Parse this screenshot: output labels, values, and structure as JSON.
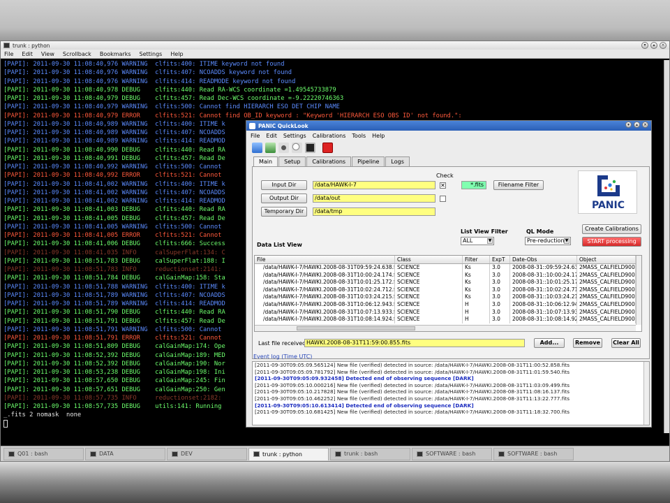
{
  "terminal": {
    "title": "trunk : python",
    "menu": [
      "File",
      "Edit",
      "View",
      "Scrollback",
      "Bookmarks",
      "Settings",
      "Help"
    ],
    "lines": [
      {
        "c": "blue",
        "t": "[PAPI]: 2011-09-30 11:08:40,976 WARNING  clfits:400: ITIME keyword not found"
      },
      {
        "c": "blue",
        "t": "[PAPI]: 2011-09-30 11:08:40,976 WARNING  clfits:407: NCOADDS keyword not found"
      },
      {
        "c": "blue",
        "t": "[PAPI]: 2011-09-30 11:08:40,976 WARNING  clfits:414: READMODE keyword not found"
      },
      {
        "c": "green",
        "t": "[PAPI]: 2011-09-30 11:08:40,978 DEBUG    clfits:440: Read RA-WCS coordinate =1.49545733879"
      },
      {
        "c": "green",
        "t": "[PAPI]: 2011-09-30 11:08:40,979 DEBUG    clfits:457: Read Dec-WCS coordinate =-9.22220746363"
      },
      {
        "c": "blue",
        "t": "[PAPI]: 2011-09-30 11:08:40,979 WARNING  clfits:500: Cannot find HIERARCH ESO DET CHIP NAME"
      },
      {
        "c": "red",
        "t": "[PAPI]: 2011-09-30 11:08:40,979 ERROR    clfits:521: Cannot find OB_ID keyword : \"Keyword 'HIERARCH ESO OBS ID' not found.\":"
      },
      {
        "c": "blue",
        "t": "[PAPI]: 2011-09-30 11:08:40,989 WARNING  clfits:400: ITIME k"
      },
      {
        "c": "blue",
        "t": "[PAPI]: 2011-09-30 11:08:40,989 WARNING  clfits:407: NCOADDS"
      },
      {
        "c": "blue",
        "t": "[PAPI]: 2011-09-30 11:08:40,989 WARNING  clfits:414: READMOD"
      },
      {
        "c": "green",
        "t": "[PAPI]: 2011-09-30 11:08:40,990 DEBUG    clfits:440: Read RA"
      },
      {
        "c": "green",
        "t": "[PAPI]: 2011-09-30 11:08:40,991 DEBUG    clfits:457: Read De"
      },
      {
        "c": "blue",
        "t": "[PAPI]: 2011-09-30 11:08:40,992 WARNING  clfits:500: Cannot"
      },
      {
        "c": "red",
        "t": "[PAPI]: 2011-09-30 11:08:40,992 ERROR    clfits:521: Cannot"
      },
      {
        "c": "blue",
        "t": "[PAPI]: 2011-09-30 11:08:41,002 WARNING  clfits:400: ITIME k"
      },
      {
        "c": "blue",
        "t": "[PAPI]: 2011-09-30 11:08:41,002 WARNING  clfits:407: NCOADDS"
      },
      {
        "c": "blue",
        "t": "[PAPI]: 2011-09-30 11:08:41,002 WARNING  clfits:414: READMOD"
      },
      {
        "c": "green",
        "t": "[PAPI]: 2011-09-30 11:08:41,003 DEBUG    clfits:440: Read RA"
      },
      {
        "c": "green",
        "t": "[PAPI]: 2011-09-30 11:08:41,005 DEBUG    clfits:457: Read De"
      },
      {
        "c": "blue",
        "t": "[PAPI]: 2011-09-30 11:08:41,005 WARNING  clfits:500: Cannot"
      },
      {
        "c": "red",
        "t": "[PAPI]: 2011-09-30 11:08:41,005 ERROR    clfits:521: Cannot"
      },
      {
        "c": "green",
        "t": "[PAPI]: 2011-09-30 11:08:41,006 DEBUG    clfits:666: Success"
      },
      {
        "c": "dred",
        "t": "[PAPI]: 2011-09-30 11:08:41,035 INFO     calSuperFlat:134: C"
      },
      {
        "c": "green",
        "t": "[PAPI]: 2011-09-30 11:08:51,783 DEBUG    calSuperFlat:188: I"
      },
      {
        "c": "dred",
        "t": "[PAPI]: 2011-09-30 11:08:51,783 INFO     reductionset:2141:"
      },
      {
        "c": "green",
        "t": "[PAPI]: 2011-09-30 11:08:51,784 DEBUG    calGainMap:158: Sta"
      },
      {
        "c": "blue",
        "t": "[PAPI]: 2011-09-30 11:08:51,788 WARNING  clfits:400: ITIME k"
      },
      {
        "c": "blue",
        "t": "[PAPI]: 2011-09-30 11:08:51,789 WARNING  clfits:407: NCOADDS"
      },
      {
        "c": "blue",
        "t": "[PAPI]: 2011-09-30 11:08:51,789 WARNING  clfits:414: READMOD"
      },
      {
        "c": "green",
        "t": "[PAPI]: 2011-09-30 11:08:51,790 DEBUG    clfits:440: Read RA"
      },
      {
        "c": "green",
        "t": "[PAPI]: 2011-09-30 11:08:51,791 DEBUG    clfits:457: Read De"
      },
      {
        "c": "blue",
        "t": "[PAPI]: 2011-09-30 11:08:51,791 WARNING  clfits:500: Cannot"
      },
      {
        "c": "red",
        "t": "[PAPI]: 2011-09-30 11:08:51,791 ERROR    clfits:521: Cannot"
      },
      {
        "c": "green",
        "t": "[PAPI]: 2011-09-30 11:08:51,809 DEBUG    calGainMap:174: Ope"
      },
      {
        "c": "green",
        "t": "[PAPI]: 2011-09-30 11:08:52,392 DEBUG    calGainMap:189: MED"
      },
      {
        "c": "green",
        "t": "[PAPI]: 2011-09-30 11:08:52,392 DEBUG    calGainMap:190: Nor"
      },
      {
        "c": "green",
        "t": "[PAPI]: 2011-09-30 11:08:53,238 DEBUG    calGainMap:198: Ini"
      },
      {
        "c": "green",
        "t": "[PAPI]: 2011-09-30 11:08:57,650 DEBUG    calGainMap:245: Fin"
      },
      {
        "c": "green",
        "t": "[PAPI]: 2011-09-30 11:08:57,651 DEBUG    calGainMap:250: Gen"
      },
      {
        "c": "dred",
        "t": "[PAPI]: 2011-09-30 11:08:57,735 INFO     reductionset:2182:"
      },
      {
        "c": "green",
        "t": "[PAPI]: 2011-09-30 11:08:57,735 DEBUG    utils:141: Running"
      },
      {
        "c": "white",
        "t": "_.fits 2 nomask  none"
      }
    ],
    "tabs": [
      {
        "label": "Q01 : bash",
        "active": false
      },
      {
        "label": "DATA",
        "active": false
      },
      {
        "label": "DEV",
        "active": false
      },
      {
        "label": "trunk : python",
        "active": true
      },
      {
        "label": "trunk : bash",
        "active": false
      },
      {
        "label": "SOFTWARE : bash",
        "active": false
      },
      {
        "label": "SOFTWARE : bash",
        "active": false
      }
    ]
  },
  "quicklook": {
    "title": "PANIC QuickLook",
    "menu": [
      "File",
      "Edit",
      "Settings",
      "Calibrations",
      "Tools",
      "Help"
    ],
    "tabs": [
      "Main",
      "Setup",
      "Calibrations",
      "Pipeline",
      "Logs"
    ],
    "main": {
      "check_label": "Check",
      "input_dir_button": "Input Dir",
      "input_dir_value": "/data/HAWK-I-7",
      "output_dir_button": "Output Dir",
      "output_dir_value": "/data/out",
      "temp_dir_button": "Temporary Dir",
      "temp_dir_value": "/data/tmp",
      "filter_pattern": "*.fits",
      "filename_filter_button": "Filename Filter",
      "logo_text": "PANIC",
      "list_view_filter_label": "List View Filter",
      "list_view_filter_value": "ALL",
      "ql_mode_label": "QL Mode",
      "ql_mode_value": "Pre-reduction",
      "create_calibrations_button": "Create Calibrations",
      "start_processing_button": "START processing",
      "data_list_view_label": "Data List View",
      "table_headers": [
        "File",
        "Class",
        "Filter",
        "ExpT",
        "Date-Obs",
        "Object"
      ],
      "table_rows": [
        [
          "/data/HAWK-I-7/HAWKI.2008-08-31T09:59:24.638.fits",
          "SCIENCE",
          "Ks",
          "3.0",
          "2008-08-31::09:59:24.6373",
          "2MASS_CALFIELD9006"
        ],
        [
          "/data/HAWK-I-7/HAWKI.2008-08-31T10:00:24.174.fits",
          "SCIENCE",
          "Ks",
          "3.0",
          "2008-08-31::10:00:24.1741",
          "2MASS_CALFIELD9006"
        ],
        [
          "/data/HAWK-I-7/HAWKI.2008-08-31T10:01:25.172.fits",
          "SCIENCE",
          "Ks",
          "3.0",
          "2008-08-31::10:01:25.1717",
          "2MASS_CALFIELD9006"
        ],
        [
          "/data/HAWK-I-7/HAWKI.2008-08-31T10:02:24.712.fits",
          "SCIENCE",
          "Ks",
          "3.0",
          "2008-08-31::10:02:24.7116",
          "2MASS_CALFIELD9006"
        ],
        [
          "/data/HAWK-I-7/HAWKI.2008-08-31T10:03:24.215.fits",
          "SCIENCE",
          "Ks",
          "3.0",
          "2008-08-31::10:03:24.2155",
          "2MASS_CALFIELD9006"
        ],
        [
          "/data/HAWK-I-7/HAWKI.2008-08-31T10:06:12.943.fits",
          "SCIENCE",
          "H",
          "3.0",
          "2008-08-31::10:06:12.9433",
          "2MASS_CALFIELD9006"
        ],
        [
          "/data/HAWK-I-7/HAWKI.2008-08-31T10:07:13.933.fits",
          "SCIENCE",
          "H",
          "3.0",
          "2008-08-31::10:07:13.9329",
          "2MASS_CALFIELD9006"
        ],
        [
          "/data/HAWK-I-7/HAWKI.2008-08-31T10:08:14.924.fits",
          "SCIENCE",
          "H",
          "3.0",
          "2008-08-31::10:08:14.9235",
          "2MASS_CALFIELD9006"
        ]
      ],
      "last_file_label": "Last file received:",
      "last_file_value": "HAWKI.2008-08-31T11:59:00.855.fits",
      "add_button": "Add...",
      "remove_button": "Remove",
      "clear_all_button": "Clear All"
    },
    "event_log_label": "Event log (Time UTC)",
    "event_log": [
      {
        "em": false,
        "t": "[2011-09-30T09:05:09.565124] New file (verified) detected in source: /data/HAWK-I-7/HAWKI.2008-08-31T11:00:52.858.fits"
      },
      {
        "em": false,
        "t": "[2011-09-30T09:05:09.781792] New file (verified) detected in source: /data/HAWK-I-7/HAWKI.2008-08-31T11:01:59.540.fits"
      },
      {
        "em": true,
        "t": "[2011-09-30T09:05:09.932458] Detected end of observing sequence [DARK]"
      },
      {
        "em": false,
        "t": "[2011-09-30T09:05:10.000216] New file (verified) detected in source: /data/HAWK-I-7/HAWKI.2008-08-31T11:03:09.499.fits"
      },
      {
        "em": false,
        "t": "[2011-09-30T09:05:10.217828] New file (verified) detected in source: /data/HAWK-I-7/HAWKI.2008-08-31T11:08:16.137.fits"
      },
      {
        "em": false,
        "t": "[2011-09-30T09:05:10.462252] New file (verified) detected in source: /data/HAWK-I-7/HAWKI.2008-08-31T11:13:22.777.fits"
      },
      {
        "em": true,
        "t": "[2011-09-30T09:05:10.613414] Detected end of observing sequence [DARK]"
      },
      {
        "em": false,
        "t": "[2011-09-30T09:05:10.681425] New file (verified) detected in source: /data/HAWK-I-7/HAWKI.2008-08-31T11:18:32.700.fits"
      }
    ]
  }
}
